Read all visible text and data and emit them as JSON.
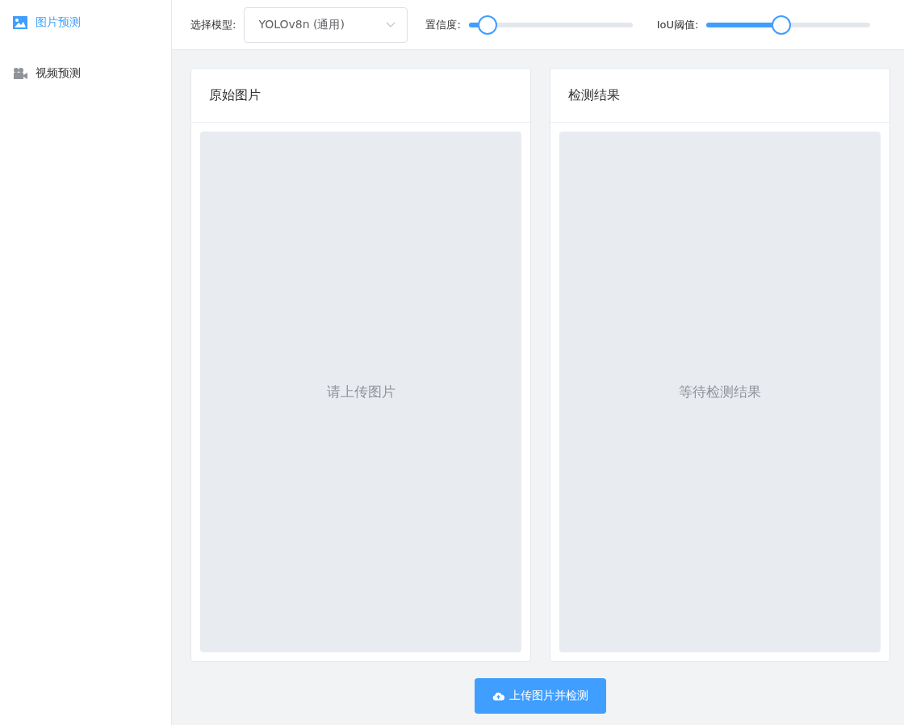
{
  "sidebar": {
    "items": [
      {
        "label": "图片预测",
        "kind": "image",
        "selected": true
      },
      {
        "label": "视频预测",
        "kind": "camera",
        "selected": false
      }
    ]
  },
  "toolbar": {
    "model_label": "选择模型:",
    "model_value": "YOLOv8n (通用)",
    "sliders": [
      {
        "label": "置信度:",
        "level": 0.11
      },
      {
        "label": "IoU阈值:",
        "level": 0.45
      }
    ]
  },
  "panels": [
    {
      "title": "原始图片",
      "placeholder": "请上传图片"
    },
    {
      "title": "检测结果",
      "placeholder": "等待检测结果"
    }
  ],
  "action_button": "上传图片并检测"
}
